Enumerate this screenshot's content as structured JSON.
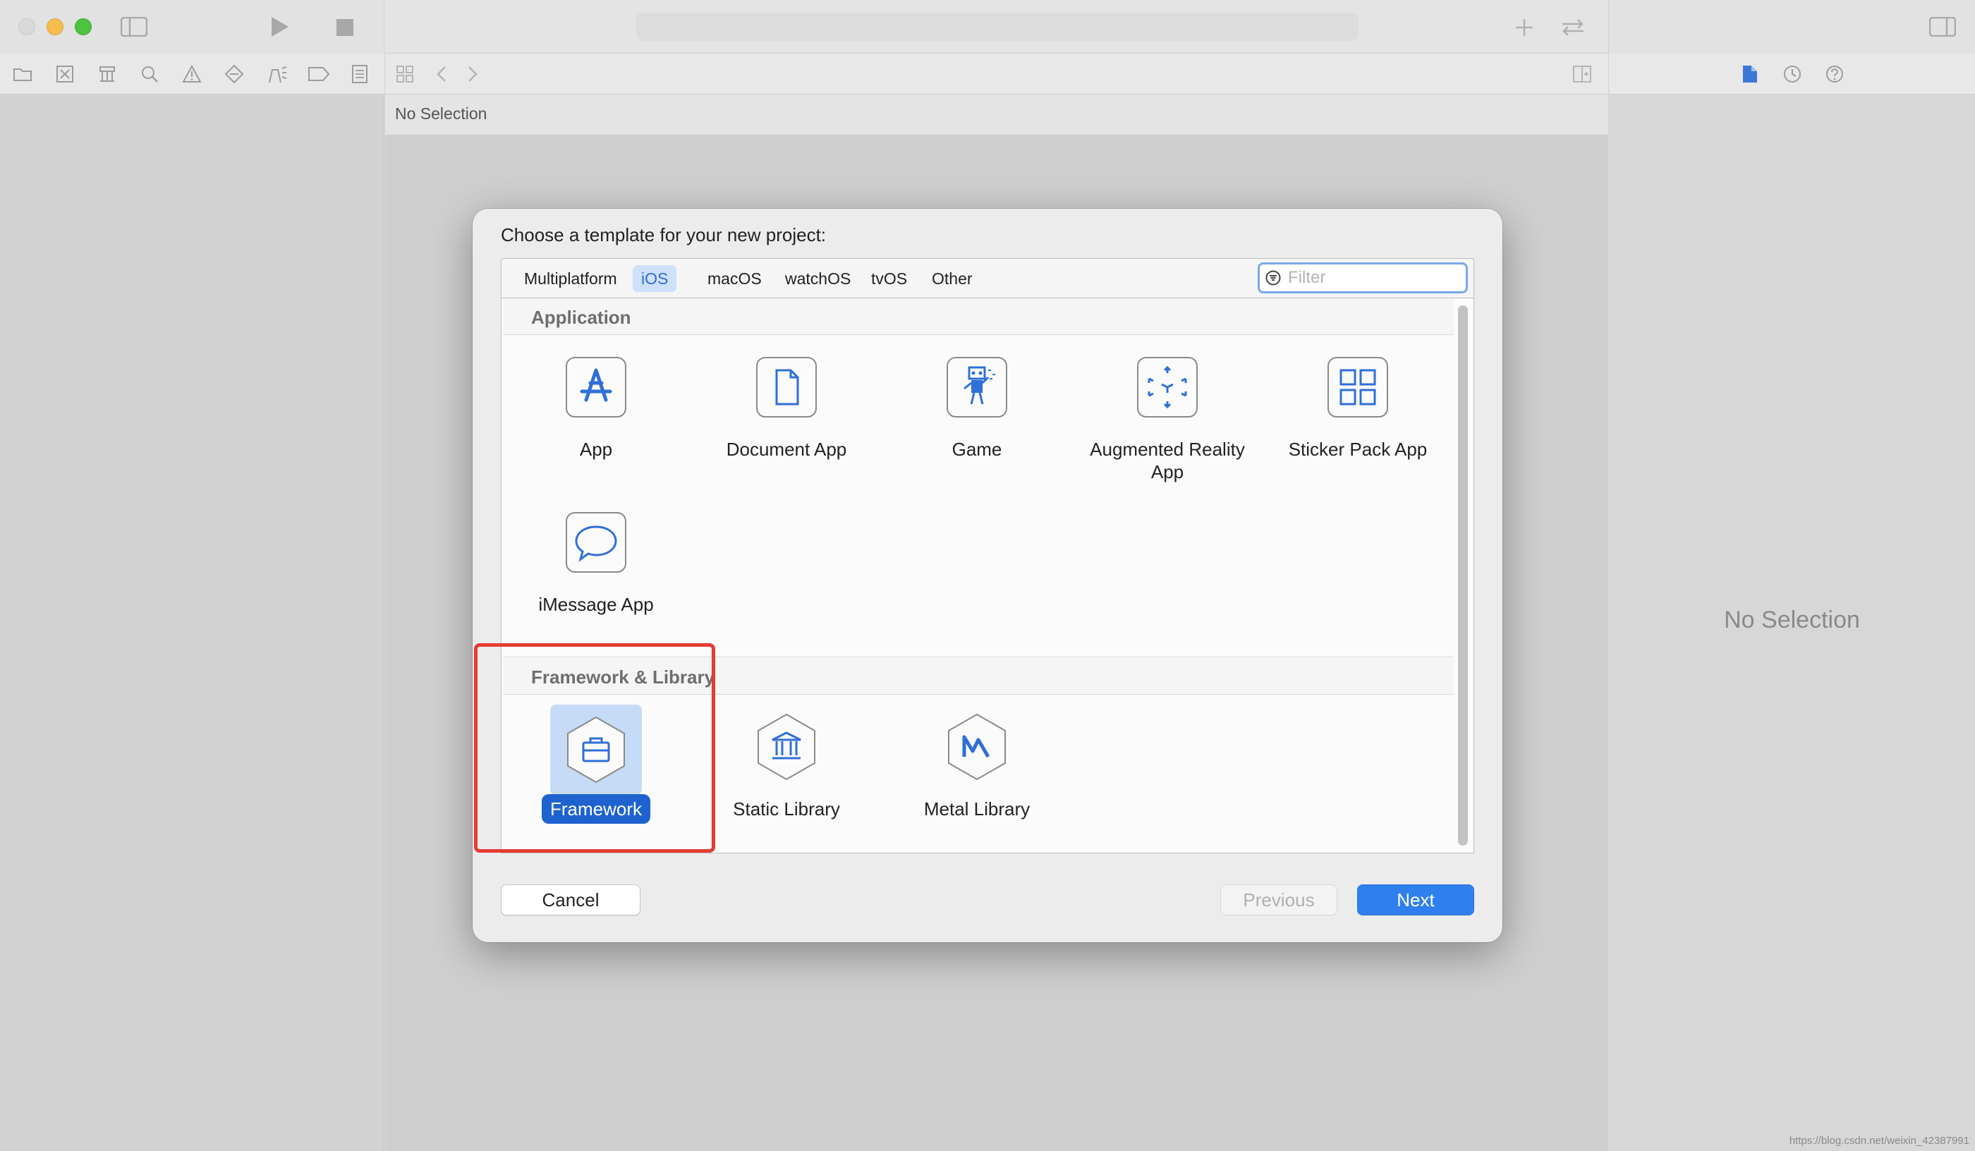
{
  "window": {
    "breadcrumb": "No Selection",
    "inspector_empty": "No Selection",
    "watermark": "https://blog.csdn.net/weixin_42387991"
  },
  "dialog": {
    "title": "Choose a template for your new project:",
    "platform_tabs": [
      "Multiplatform",
      "iOS",
      "macOS",
      "watchOS",
      "tvOS",
      "Other"
    ],
    "active_tab": "iOS",
    "filter_placeholder": "Filter",
    "filter_value": "",
    "sections": [
      {
        "title": "Application",
        "items": [
          {
            "label": "App",
            "icon": "app-store-icon"
          },
          {
            "label": "Document App",
            "icon": "document-icon"
          },
          {
            "label": "Game",
            "icon": "game-robot-icon"
          },
          {
            "label": "Augmented Reality App",
            "icon": "ar-cube-icon"
          },
          {
            "label": "Sticker Pack App",
            "icon": "sticker-grid-icon"
          },
          {
            "label": "iMessage App",
            "icon": "speech-bubble-icon"
          }
        ]
      },
      {
        "title": "Framework & Library",
        "items": [
          {
            "label": "Framework",
            "icon": "framework-toolbox-icon",
            "selected": true
          },
          {
            "label": "Static Library",
            "icon": "static-library-icon"
          },
          {
            "label": "Metal Library",
            "icon": "metal-library-icon"
          }
        ]
      }
    ],
    "buttons": {
      "cancel": "Cancel",
      "previous": "Previous",
      "next": "Next"
    },
    "colors": {
      "accent": "#2f80ee",
      "selection": "#1e62d0",
      "annotation": "#e53b34"
    }
  }
}
